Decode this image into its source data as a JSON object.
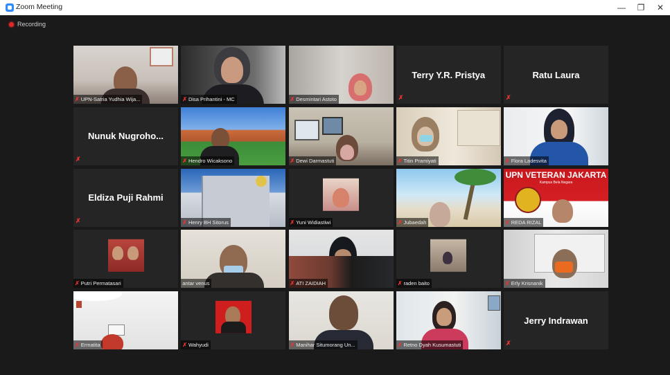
{
  "window": {
    "title": "Zoom Meeting",
    "minimize": "—",
    "restore": "❐",
    "close": "✕"
  },
  "recording": {
    "label": "Recording"
  },
  "mute_glyph": "✗",
  "participants": [
    {
      "name": "UPN-Satria Yudhia Wija...",
      "video": true
    },
    {
      "name": "Disa Prihantini - MC",
      "video": true
    },
    {
      "name": "Desmintari Astoto",
      "video": true
    },
    {
      "name": "Terry Y.R. Pristya",
      "video": false
    },
    {
      "name": "Ratu Laura",
      "video": false
    },
    {
      "name": "Nunuk  Nugroho...",
      "video": false
    },
    {
      "name": "Hendro Wicaksono",
      "video": true
    },
    {
      "name": "Dewi Darmastuti",
      "video": true
    },
    {
      "name": "Titin Pramiyati",
      "video": true
    },
    {
      "name": "Flora Ladesvita",
      "video": true
    },
    {
      "name": "Eldiza Puji Rahmi",
      "video": false
    },
    {
      "name": "Henry BH Sitorus",
      "video": true
    },
    {
      "name": "Yuni Widiastiwi",
      "video": true
    },
    {
      "name": "Jubaedah",
      "video": true
    },
    {
      "name": "REDA RIZAL",
      "video": true
    },
    {
      "name": "Putri Permatasari",
      "video": true
    },
    {
      "name": "antar venus",
      "video": true
    },
    {
      "name": "ATI ZAIDIAH",
      "video": true
    },
    {
      "name": "raden baito",
      "video": true
    },
    {
      "name": "Erly Krisnanik",
      "video": true
    },
    {
      "name": "Ermatita",
      "video": true
    },
    {
      "name": "Wahyudi",
      "video": true
    },
    {
      "name": "Manihar Situmorang Un...",
      "video": true
    },
    {
      "name": "Retno Dyah Kusumastuti",
      "video": true
    },
    {
      "name": "Jerry Indrawan",
      "video": false
    }
  ],
  "reda_tile": {
    "banner": "UPN VETERAN JAKARTA",
    "sub": "Kampus Bela Negara"
  }
}
